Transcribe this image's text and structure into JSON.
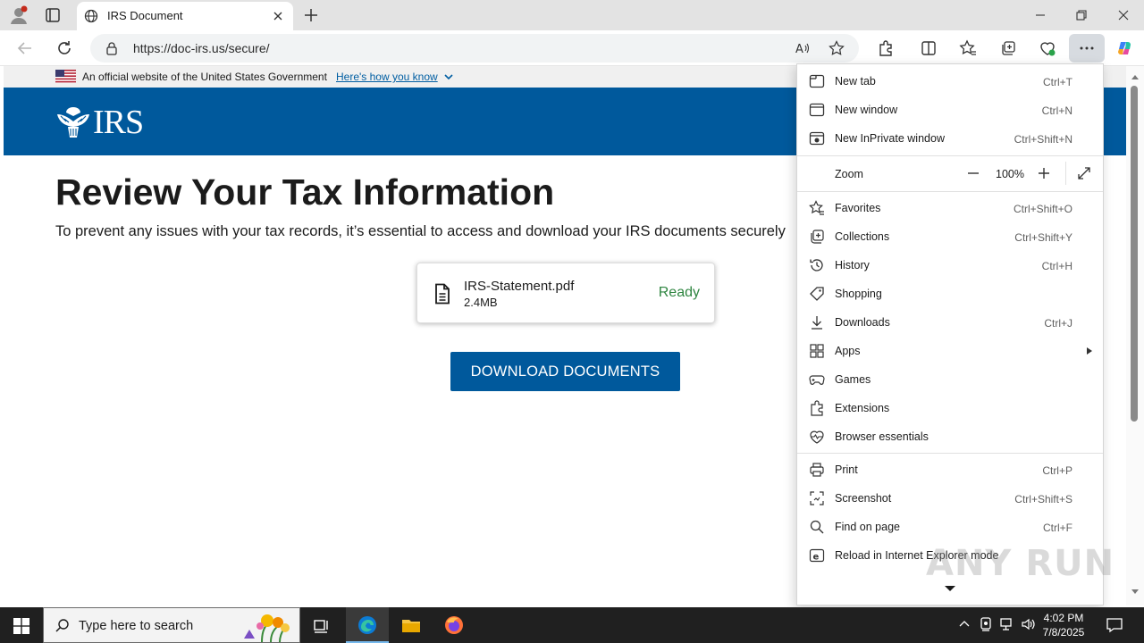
{
  "browser": {
    "tab_title": "IRS Document",
    "url": "https://doc-irs.us/secure/"
  },
  "gov_banner": {
    "text": "An official website of the United States Government",
    "link": "Here's how you know"
  },
  "header": {
    "logo_text": "IRS"
  },
  "main": {
    "heading": "Review Your Tax Information",
    "description": "To prevent any issues with your tax records, it’s essential to access and download your IRS documents securely",
    "file": {
      "name": "IRS-Statement.pdf",
      "size": "2.4MB",
      "status": "Ready"
    },
    "download_label": "DOWNLOAD DOCUMENTS"
  },
  "menu": {
    "items_top": [
      {
        "label": "New tab",
        "shortcut": "Ctrl+T",
        "icon": "new-tab-icon"
      },
      {
        "label": "New window",
        "shortcut": "Ctrl+N",
        "icon": "new-window-icon"
      },
      {
        "label": "New InPrivate window",
        "shortcut": "Ctrl+Shift+N",
        "icon": "inprivate-icon"
      }
    ],
    "zoom": {
      "label": "Zoom",
      "value": "100%"
    },
    "items_mid": [
      {
        "label": "Favorites",
        "shortcut": "Ctrl+Shift+O",
        "icon": "favorites-icon"
      },
      {
        "label": "Collections",
        "shortcut": "Ctrl+Shift+Y",
        "icon": "collections-icon"
      },
      {
        "label": "History",
        "shortcut": "Ctrl+H",
        "icon": "history-icon"
      },
      {
        "label": "Shopping",
        "shortcut": "",
        "icon": "shopping-icon"
      },
      {
        "label": "Downloads",
        "shortcut": "Ctrl+J",
        "icon": "downloads-icon"
      },
      {
        "label": "Apps",
        "shortcut": "",
        "icon": "apps-icon"
      },
      {
        "label": "Games",
        "shortcut": "",
        "icon": "games-icon"
      },
      {
        "label": "Extensions",
        "shortcut": "",
        "icon": "extensions-icon"
      },
      {
        "label": "Browser essentials",
        "shortcut": "",
        "icon": "browser-essentials-icon"
      }
    ],
    "items_bottom": [
      {
        "label": "Print",
        "shortcut": "Ctrl+P",
        "icon": "print-icon"
      },
      {
        "label": "Screenshot",
        "shortcut": "Ctrl+Shift+S",
        "icon": "screenshot-icon"
      },
      {
        "label": "Find on page",
        "shortcut": "Ctrl+F",
        "icon": "find-icon"
      },
      {
        "label": "Reload in Internet Explorer mode",
        "shortcut": "",
        "icon": "ie-mode-icon"
      }
    ]
  },
  "watermark": "ANY RUN",
  "taskbar": {
    "search_placeholder": "Type here to search",
    "time": "4:02 PM",
    "date": "7/8/2025"
  }
}
